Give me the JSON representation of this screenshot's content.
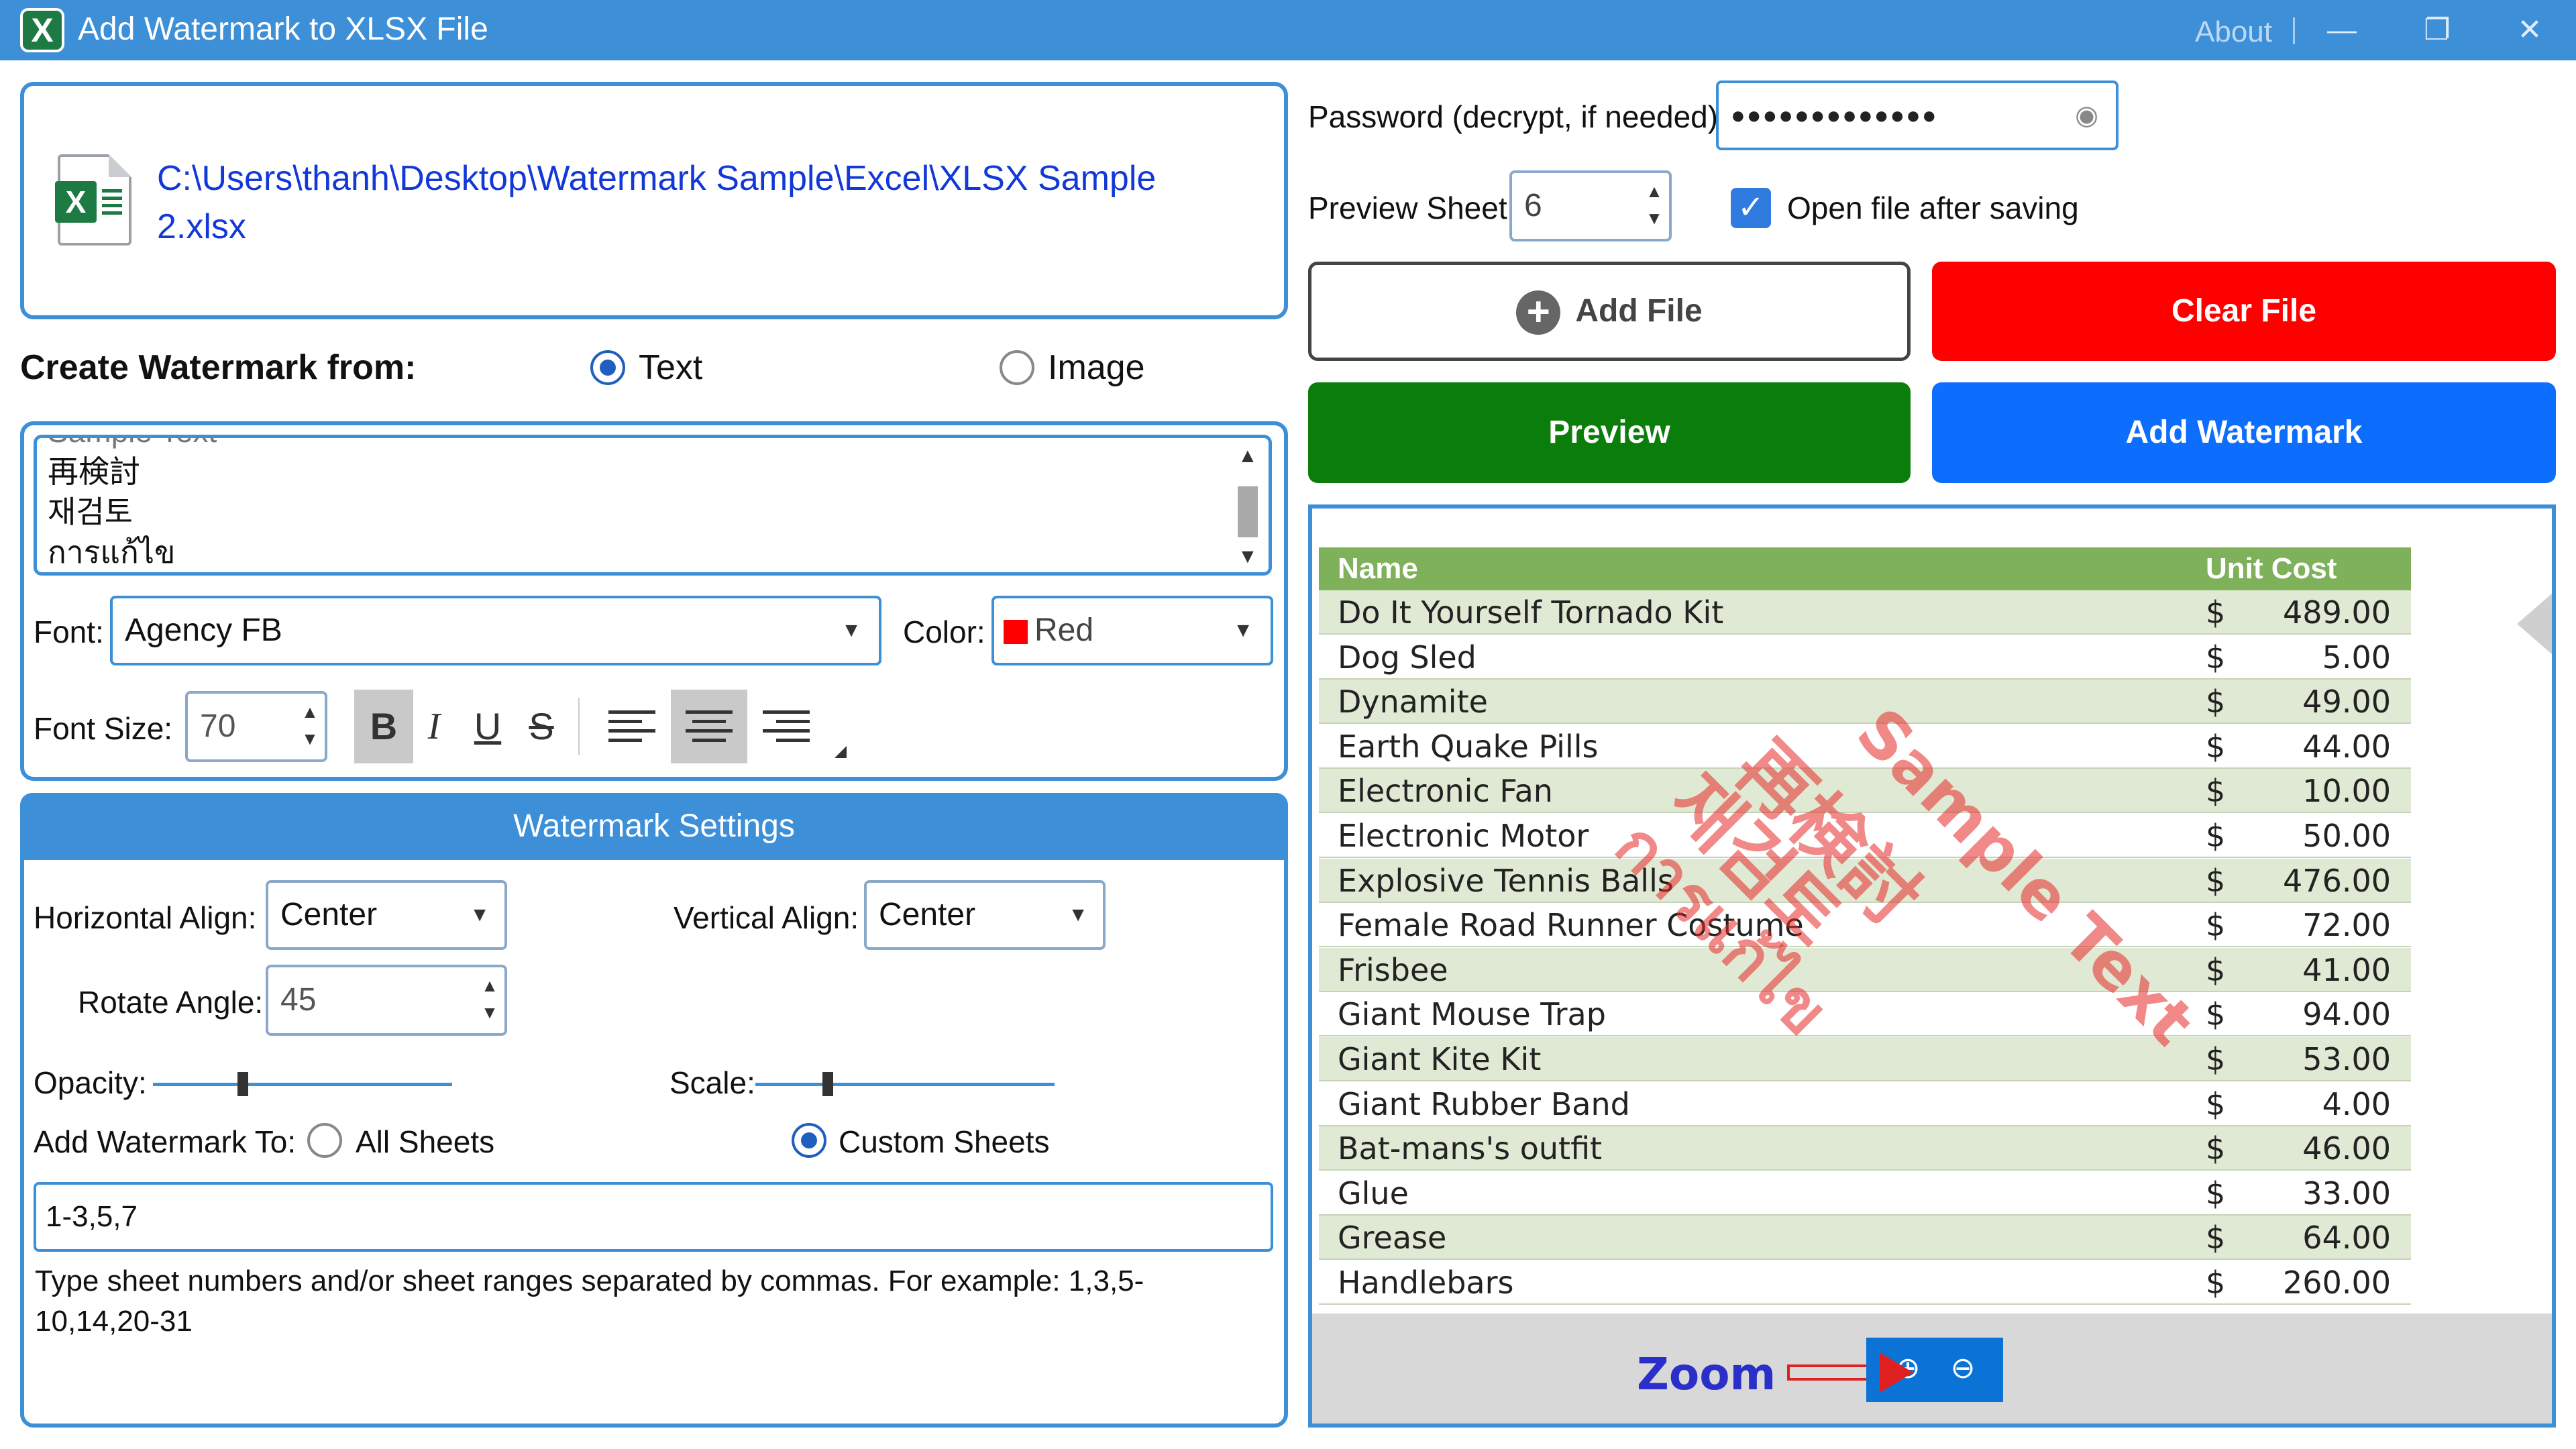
{
  "window": {
    "title": "Add Watermark to XLSX File",
    "about": "About",
    "minimize": "—",
    "maximize": "❐",
    "close": "✕"
  },
  "file": {
    "path": "C:\\Users\\thanh\\Desktop\\Watermark Sample\\Excel\\XLSX Sample 2.xlsx"
  },
  "create_from": {
    "label": "Create Watermark from:",
    "options": [
      "Text",
      "Image"
    ],
    "selected": "Text"
  },
  "watermark_text": {
    "lines": [
      "Sample Text",
      "再検討",
      "재검토",
      "การแก้ไข"
    ]
  },
  "font": {
    "label": "Font:",
    "value": "Agency FB",
    "color_label": "Color:",
    "color_value": "Red",
    "color_hex": "#ff0000",
    "size_label": "Font Size:",
    "size_value": "70"
  },
  "format_tools": {
    "bold": "B",
    "italic": "I",
    "underline": "U",
    "strike": "S"
  },
  "settings": {
    "header": "Watermark Settings",
    "horizontal_label": "Horizontal Align:",
    "horizontal_value": "Center",
    "vertical_label": "Vertical Align:",
    "vertical_value": "Center",
    "rotate_label": "Rotate Angle:",
    "rotate_value": "45",
    "opacity_label": "Opacity:",
    "scale_label": "Scale:",
    "add_to_label": "Add Watermark To:",
    "all_sheets": "All Sheets",
    "custom_sheets": "Custom Sheets",
    "selected_target": "Custom Sheets",
    "sheet_range": "1-3,5,7",
    "hint": "Type sheet numbers and/or sheet ranges separated by commas. For example: 1,3,5-10,14,20-31"
  },
  "right_panel": {
    "password_label": "Password (decrypt, if needed):",
    "password_mask": "●●●●●●●●●●●●●",
    "preview_sheet_label": "Preview Sheet:",
    "preview_sheet_value": "6",
    "open_after_label": "Open file after saving",
    "open_after_checked": true,
    "add_file": "Add File",
    "clear_file": "Clear File",
    "preview": "Preview",
    "add_watermark": "Add Watermark"
  },
  "preview_sheet": {
    "headers": [
      "Name",
      "Unit Cost"
    ],
    "rows": [
      {
        "name": "Do It Yourself Tornado Kit",
        "currency": "$",
        "cost": "489.00"
      },
      {
        "name": "Dog Sled",
        "currency": "$",
        "cost": "5.00"
      },
      {
        "name": "Dynamite",
        "currency": "$",
        "cost": "49.00"
      },
      {
        "name": "Earth Quake Pills",
        "currency": "$",
        "cost": "44.00"
      },
      {
        "name": "Electronic Fan",
        "currency": "$",
        "cost": "10.00"
      },
      {
        "name": "Electronic Motor",
        "currency": "$",
        "cost": "50.00"
      },
      {
        "name": "Explosive Tennis Balls",
        "currency": "$",
        "cost": "476.00"
      },
      {
        "name": "Female Road Runner Costume",
        "currency": "$",
        "cost": "72.00"
      },
      {
        "name": "Frisbee",
        "currency": "$",
        "cost": "41.00"
      },
      {
        "name": "Giant Mouse Trap",
        "currency": "$",
        "cost": "94.00"
      },
      {
        "name": "Giant Kite Kit",
        "currency": "$",
        "cost": "53.00"
      },
      {
        "name": "Giant Rubber Band",
        "currency": "$",
        "cost": "4.00"
      },
      {
        "name": "Bat-mans's outfit",
        "currency": "$",
        "cost": "46.00"
      },
      {
        "name": "Glue",
        "currency": "$",
        "cost": "33.00"
      },
      {
        "name": "Grease",
        "currency": "$",
        "cost": "64.00"
      },
      {
        "name": "Handlebars",
        "currency": "$",
        "cost": "260.00"
      }
    ],
    "watermark_lines": [
      "Sample Text",
      "再検討",
      "재검토",
      "การแก้ไข"
    ],
    "zoom_label": "Zoom"
  },
  "colors": {
    "accent": "#3d8fd8",
    "clear": "#ff0000",
    "preview": "#0a7d0a",
    "add_watermark": "#0d6efd"
  }
}
